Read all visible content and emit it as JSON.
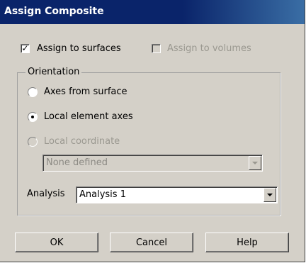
{
  "window": {
    "title": "Assign Composite"
  },
  "options": {
    "assign_surfaces": {
      "label": "Assign to surfaces",
      "checked": true,
      "check_glyph": "✓"
    },
    "assign_volumes": {
      "label": "Assign to volumes",
      "checked": false,
      "enabled": false
    }
  },
  "orientation": {
    "label": "Orientation",
    "choices": [
      {
        "label": "Axes from surface",
        "selected": false,
        "enabled": true
      },
      {
        "label": "Local element axes",
        "selected": true,
        "enabled": true
      },
      {
        "label": "Local coordinate",
        "selected": false,
        "enabled": false
      }
    ],
    "coordinate_system": {
      "value": "None defined",
      "enabled": false
    },
    "analysis": {
      "label": "Analysis",
      "value": "Analysis 1"
    }
  },
  "buttons": {
    "ok": "OK",
    "cancel": "Cancel",
    "help": "Help"
  }
}
